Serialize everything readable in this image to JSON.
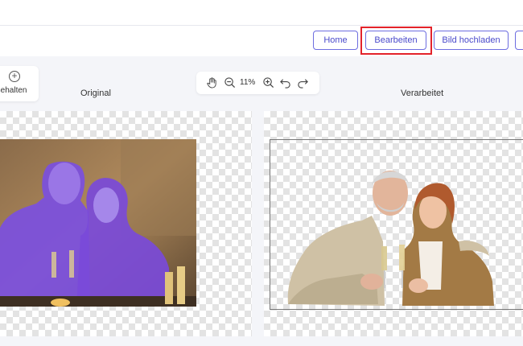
{
  "nav": {
    "home_label": "Home",
    "edit_label": "Bearbeiten",
    "upload_label": "Bild hochladen"
  },
  "keep": {
    "label": "Behalten",
    "icon": "plus-circle-icon"
  },
  "toolbar": {
    "zoom": "11%",
    "icons": [
      "hand-icon",
      "zoom-out-icon",
      "zoom-in-icon",
      "undo-icon",
      "redo-icon"
    ]
  },
  "panes": {
    "original_title": "Original",
    "processed_title": "Verarbeitet"
  },
  "colors": {
    "accent": "#4a4acb",
    "highlight": "#e3232a",
    "overlay": "#7b4fe0"
  }
}
